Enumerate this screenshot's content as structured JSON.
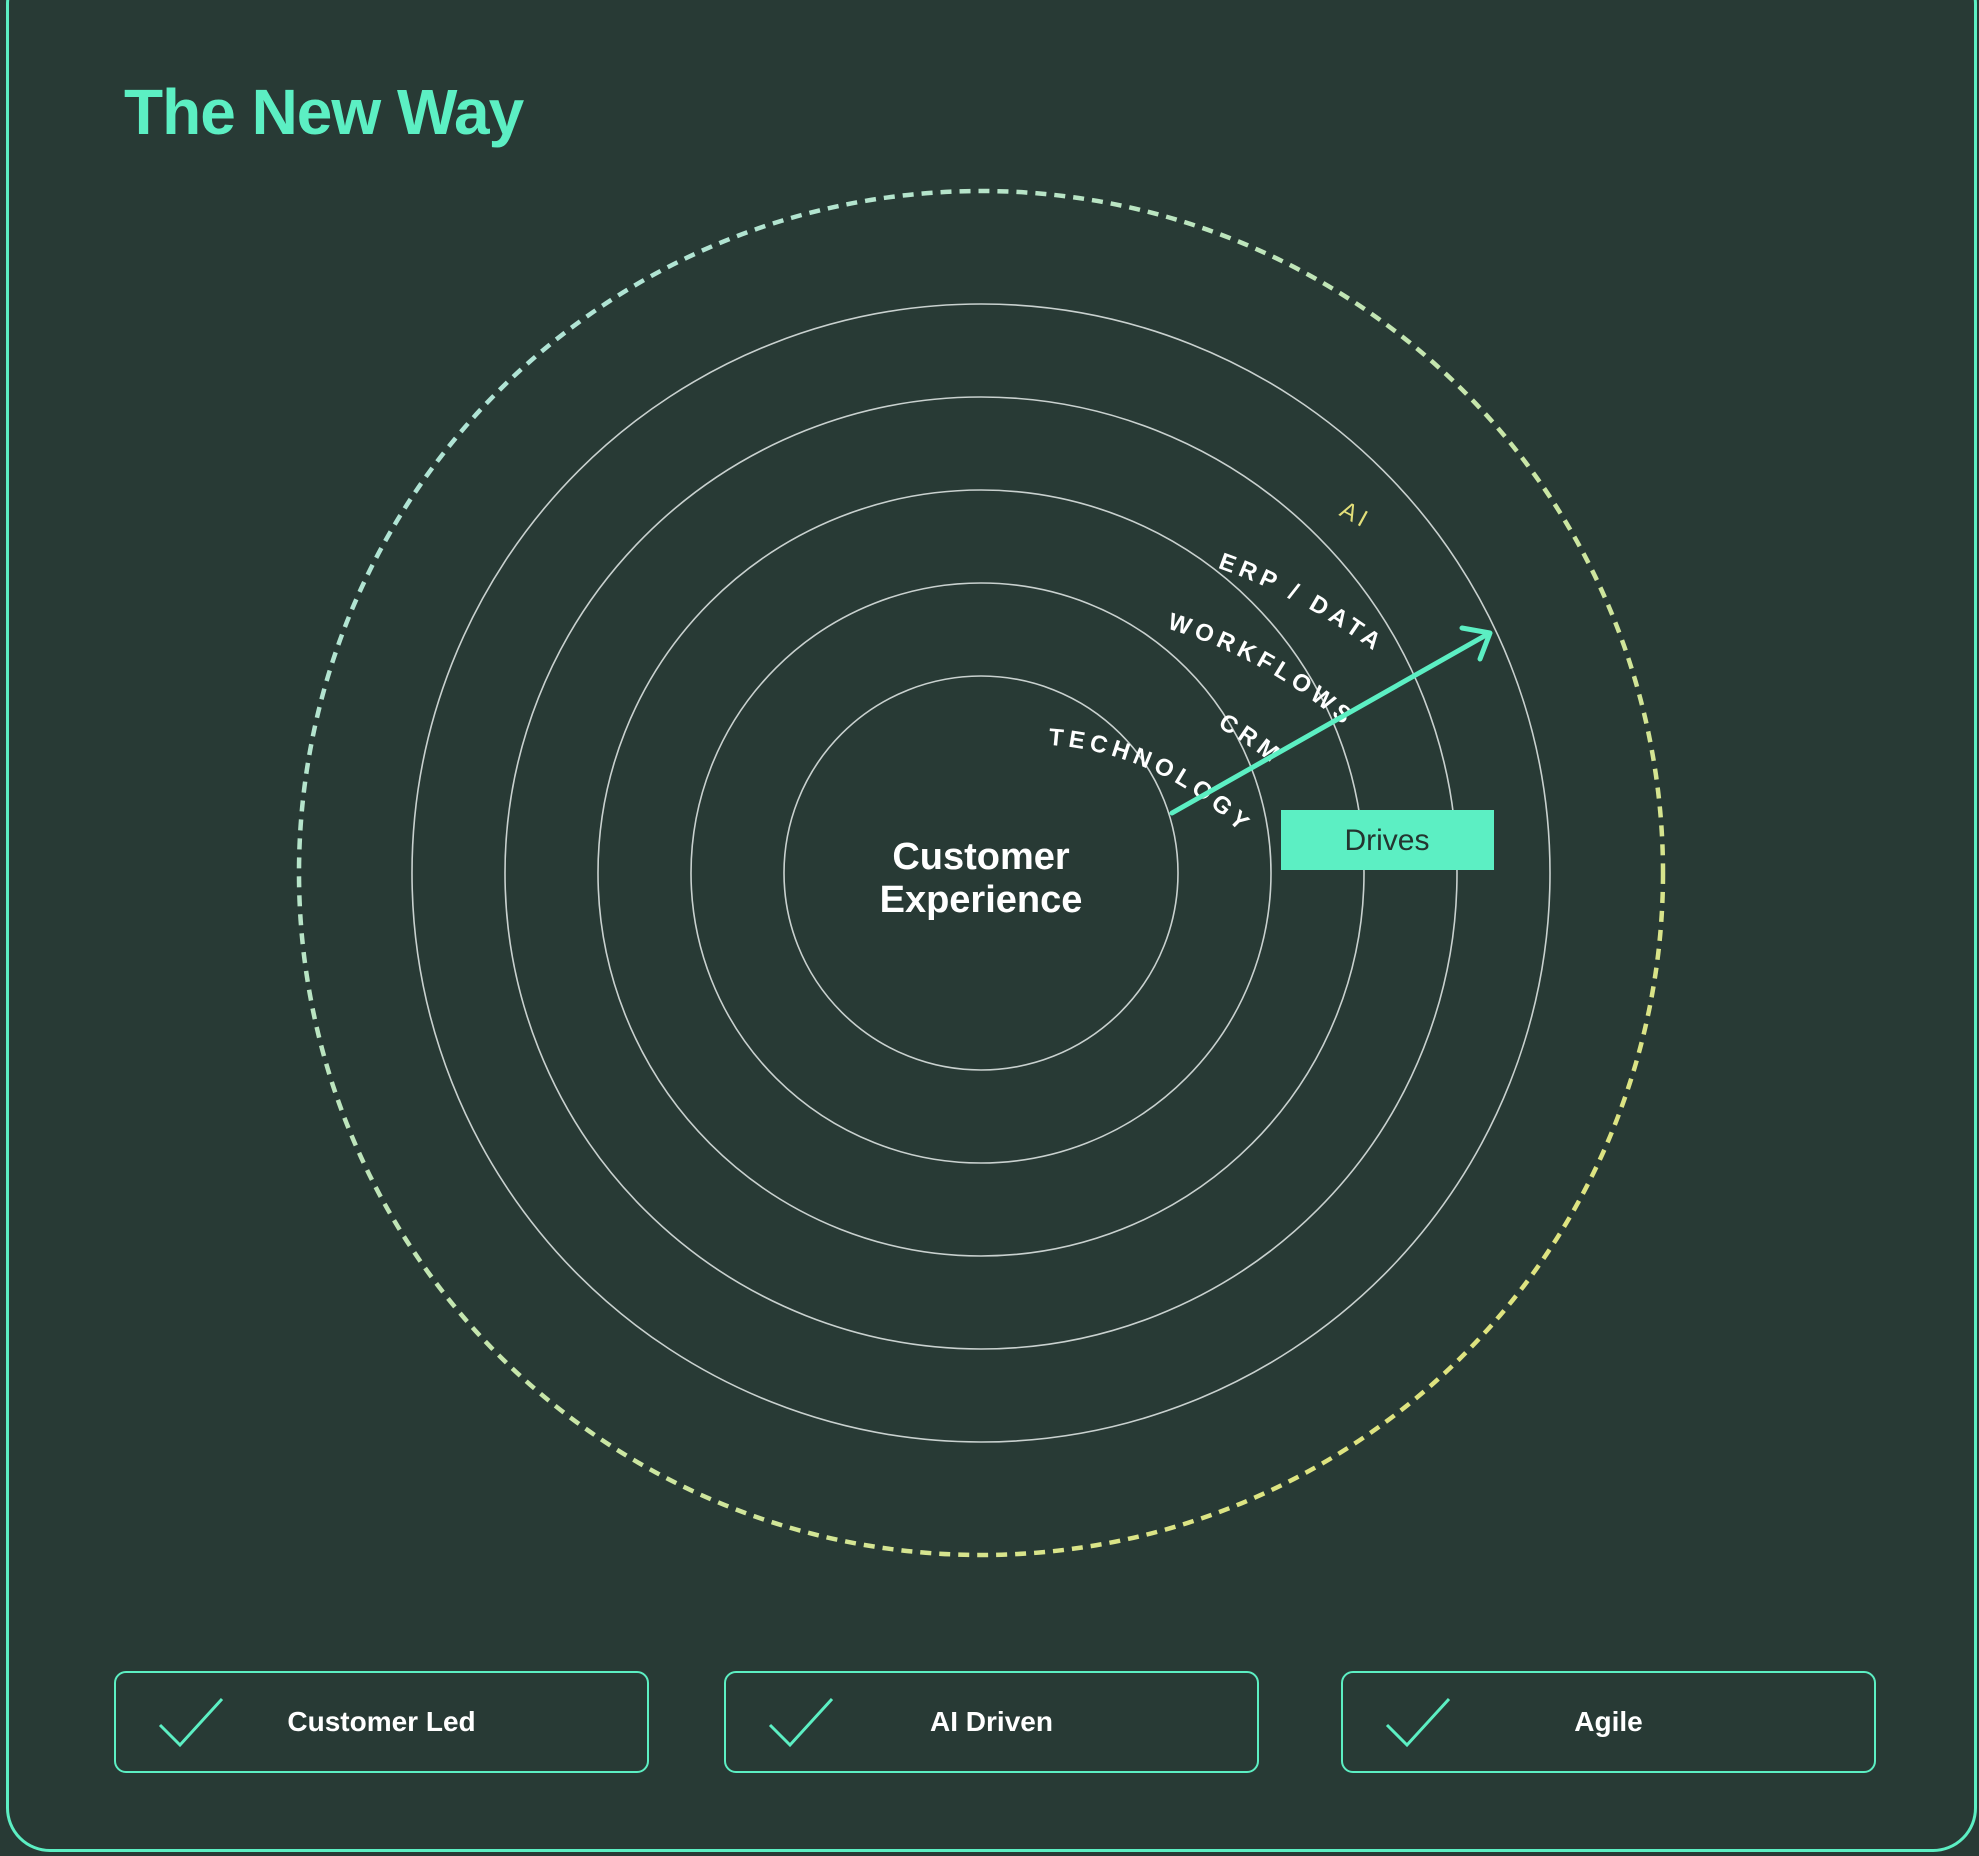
{
  "title": "The New Way",
  "diagram": {
    "center_label_line1": "Customer",
    "center_label_line2": "Experience",
    "rings": [
      "TECHNOLOGY",
      "CRM",
      "WORKFLOWS",
      "ERP / DATA"
    ],
    "outer_ring_label": "AI",
    "arrow_label": "Drives"
  },
  "principles": [
    {
      "label": "Customer Led",
      "icon": "check-icon"
    },
    {
      "label": "AI Driven",
      "icon": "check-icon"
    },
    {
      "label": "Agile",
      "icon": "check-icon"
    }
  ],
  "colors": {
    "background": "#283a35",
    "accent": "#5cefc3",
    "ring_stroke": "#c9d1cf",
    "ai_gradient_start": "#a6e3e6",
    "ai_gradient_end": "#e9e26c",
    "text": "#ffffff",
    "drives_text": "#243530"
  }
}
